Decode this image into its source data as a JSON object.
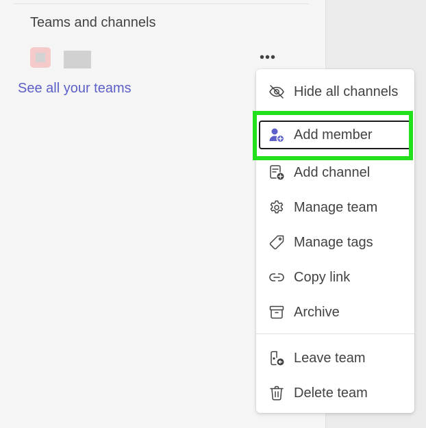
{
  "sidebar": {
    "section_title": "Teams and channels",
    "see_all_link": "See all your teams",
    "more_options_label": "•••"
  },
  "context_menu": {
    "items": [
      {
        "label": "Hide all channels",
        "icon": "eye-off-icon"
      },
      {
        "label": "Add member",
        "icon": "person-add-icon"
      },
      {
        "label": "Add channel",
        "icon": "channel-add-icon"
      },
      {
        "label": "Manage team",
        "icon": "gear-icon"
      },
      {
        "label": "Manage tags",
        "icon": "tag-icon"
      },
      {
        "label": "Copy link",
        "icon": "link-icon"
      },
      {
        "label": "Archive",
        "icon": "archive-icon"
      },
      {
        "label": "Leave team",
        "icon": "leave-icon"
      },
      {
        "label": "Delete team",
        "icon": "trash-icon"
      }
    ]
  },
  "colors": {
    "accent": "#5b5fc7",
    "highlight": "#22e01b",
    "text": "#424242"
  }
}
